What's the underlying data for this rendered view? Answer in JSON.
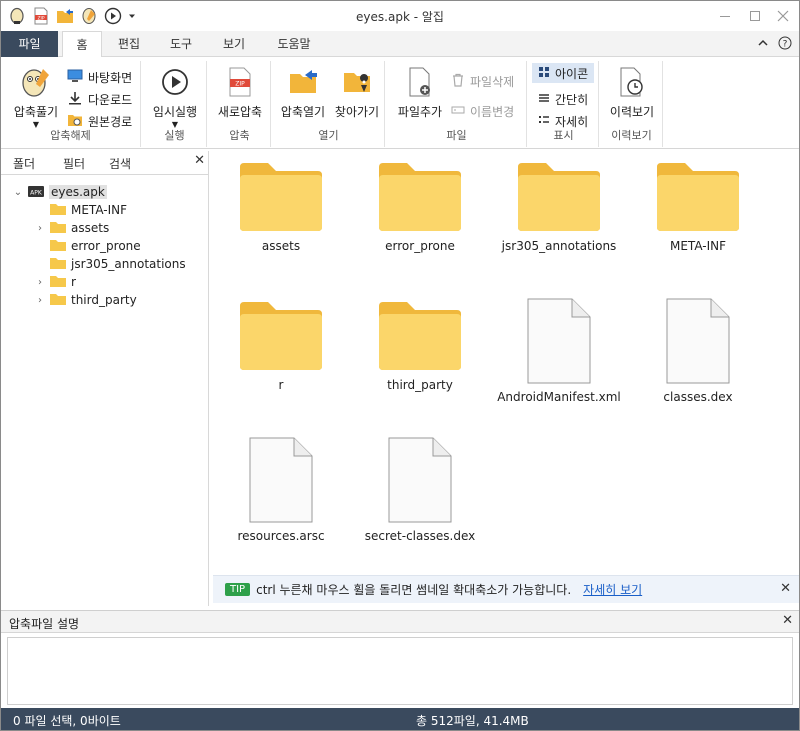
{
  "window": {
    "title": "eyes.apk - 알집"
  },
  "quick_access": {
    "icons": [
      "alzip-logo-icon",
      "zip-icon",
      "folder-open-icon",
      "compress-icon",
      "play-icon",
      "dropdown-arrow-icon"
    ]
  },
  "window_controls": {
    "minimize": "-",
    "maximize": "□",
    "close": "✕"
  },
  "menu": {
    "tabs": [
      "파일",
      "홈",
      "편집",
      "도구",
      "보기",
      "도움말"
    ],
    "active": "홈",
    "right_icons": [
      "collapse-ribbon-icon",
      "help-icon"
    ]
  },
  "ribbon": {
    "groups": [
      {
        "label": "압축해제",
        "big": "압축풀기",
        "small": [
          "바탕화면",
          "다운로드",
          "원본경로"
        ]
      },
      {
        "label": "실행",
        "big": "임시실행"
      },
      {
        "label": "압축",
        "big": "새로압축"
      },
      {
        "label": "열기",
        "bigs": [
          "압축열기",
          "찾아가기"
        ]
      },
      {
        "label": "파일",
        "big": "파일추가",
        "small": [
          "파일삭제",
          "이름변경"
        ]
      },
      {
        "label": "표시",
        "small": [
          "아이콘",
          "간단히",
          "자세히"
        ],
        "selected": "아이콘"
      },
      {
        "label": "이력보기",
        "big": "이력보기"
      }
    ]
  },
  "left_panel": {
    "tabs": [
      "폴더",
      "필터",
      "검색"
    ],
    "close": "✕",
    "tree": {
      "root": "eyes.apk",
      "children": [
        {
          "name": "META-INF",
          "expandable": false
        },
        {
          "name": "assets",
          "expandable": true
        },
        {
          "name": "error_prone",
          "expandable": false
        },
        {
          "name": "jsr305_annotations",
          "expandable": false
        },
        {
          "name": "r",
          "expandable": true
        },
        {
          "name": "third_party",
          "expandable": true
        }
      ]
    }
  },
  "files": [
    {
      "name": "assets",
      "type": "folder"
    },
    {
      "name": "error_prone",
      "type": "folder"
    },
    {
      "name": "jsr305_annotations",
      "type": "folder"
    },
    {
      "name": "META-INF",
      "type": "folder"
    },
    {
      "name": "r",
      "type": "folder"
    },
    {
      "name": "third_party",
      "type": "folder"
    },
    {
      "name": "AndroidManifest.xml",
      "type": "file"
    },
    {
      "name": "classes.dex",
      "type": "file"
    },
    {
      "name": "resources.arsc",
      "type": "file"
    },
    {
      "name": "secret-classes.dex",
      "type": "file"
    }
  ],
  "tip": {
    "badge": "TIP",
    "text": "ctrl 누른채 마우스 휠을 돌리면 썸네일 확대축소가 가능합니다.",
    "link": "자세히 보기",
    "close": "✕"
  },
  "description_panel": {
    "title": "압축파일 설명",
    "close": "✕"
  },
  "status": {
    "selection": "0 파일 선택,  0바이트",
    "total": "총 512파일,  41.4MB"
  },
  "colors": {
    "accent": "#3a4a5e",
    "folder": "#f6c84a",
    "link": "#1a5fc8",
    "tip": "#2ea04a",
    "selected": "#dbe6f4"
  }
}
